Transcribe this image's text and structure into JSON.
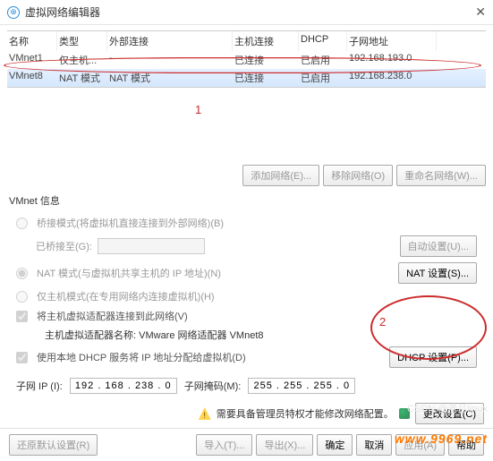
{
  "title": "虚拟网络编辑器",
  "table": {
    "headers": [
      "名称",
      "类型",
      "外部连接",
      "主机连接",
      "DHCP",
      "子网地址"
    ],
    "rows": [
      {
        "name": "VMnet1",
        "type": "仅主机...",
        "ext": "-",
        "host": "已连接",
        "dhcp": "已启用",
        "subnet": "192.168.193.0"
      },
      {
        "name": "VMnet8",
        "type": "NAT 模式",
        "ext": "NAT 模式",
        "host": "已连接",
        "dhcp": "已启用",
        "subnet": "192.168.238.0"
      }
    ]
  },
  "annotations": {
    "a1": "1",
    "a2": "2"
  },
  "mid_buttons": {
    "add": "添加网络(E)...",
    "remove": "移除网络(O)",
    "rename": "重命名网络(W)..."
  },
  "section_title": "VMnet 信息",
  "opts": {
    "bridge": "桥接模式(将虚拟机直接连接到外部网络)(B)",
    "bridge_to": "已桥接至(G):",
    "bridge_auto": "自动设置(U)...",
    "nat": "NAT 模式(与虚拟机共享主机的 IP 地址)(N)",
    "nat_settings": "NAT 设置(S)...",
    "hostonly": "仅主机模式(在专用网络内连接虚拟机)(H)",
    "connect_host": "将主机虚拟适配器连接到此网络(V)",
    "host_adapter_label": "主机虚拟适配器名称:",
    "host_adapter_name": "VMware 网络适配器 VMnet8",
    "use_dhcp": "使用本地 DHCP 服务将 IP 地址分配给虚拟机(D)",
    "dhcp_settings": "DHCP 设置(P)..."
  },
  "subnet": {
    "ip_label": "子网 IP (I):",
    "ip_value": "192 . 168 . 238 . 0",
    "mask_label": "子网掩码(M):",
    "mask_value": "255 . 255 . 255 . 0"
  },
  "warning": "需要具备管理员特权才能修改网络配置。",
  "change_settings": "更改设置(C)",
  "bottom": {
    "restore": "还原默认设置(R)",
    "import": "导入(T)...",
    "export": "导出(X)...",
    "ok": "确定",
    "cancel": "取消",
    "apply": "应用(A)",
    "help": "帮助"
  },
  "watermark_csdn": "CSDN @老吕linux",
  "watermark_site": "www.9969.net"
}
